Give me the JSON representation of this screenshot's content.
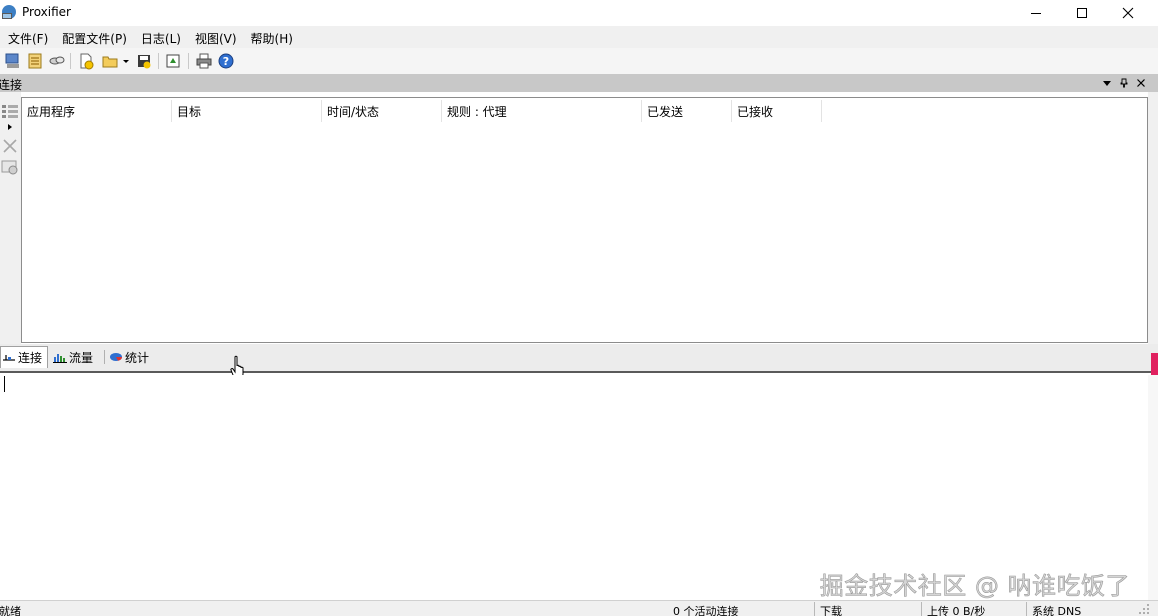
{
  "window": {
    "title": "Proxifier"
  },
  "menu": [
    "文件(F)",
    "配置文件(P)",
    "日志(L)",
    "视图(V)",
    "帮助(H)"
  ],
  "panel": {
    "title": "连接"
  },
  "table": {
    "columns": [
      "应用程序",
      "目标",
      "时间/状态",
      "规则 : 代理",
      "已发送",
      "已接收"
    ]
  },
  "tabs": [
    {
      "label": "连接",
      "icon": "connection-icon",
      "active": true
    },
    {
      "label": "流量",
      "icon": "traffic-chart-icon",
      "active": false
    },
    {
      "label": "统计",
      "icon": "statistics-pie-icon",
      "active": false
    }
  ],
  "watermark": "掘金技术社区 @ 呐谁吃饭了",
  "status": {
    "ready": "就绪",
    "active_connections": "0 个活动连接",
    "download": "下载",
    "upload": "上传 0 B/秒",
    "dns": "系统 DNS"
  },
  "colors": {
    "accent_pink": "#e0215f",
    "panel_header": "#c8c8c8"
  }
}
